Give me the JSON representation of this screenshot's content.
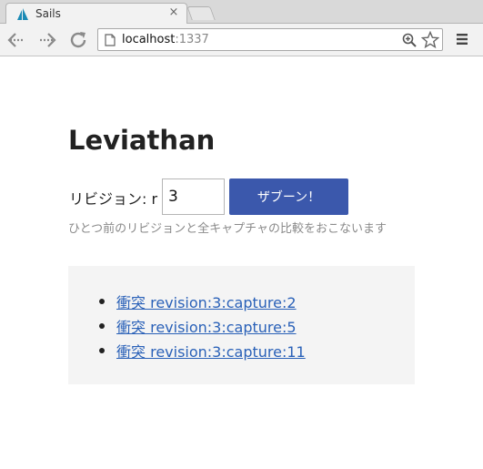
{
  "browser": {
    "tab_title": "Sails",
    "tab_close": "×",
    "url_host": "localhost",
    "url_port": ":1337"
  },
  "page": {
    "title": "Leviathan",
    "revision_label": "リビジョン: r",
    "revision_value": "3",
    "submit_label": "ザブーン！",
    "help_text": "ひとつ前のリビジョンと全キャプチャの比較をおこないます",
    "conflicts": [
      {
        "label": "衝突 revision:3:capture:2"
      },
      {
        "label": "衝突 revision:3:capture:5"
      },
      {
        "label": "衝突 revision:3:capture:11"
      }
    ]
  },
  "colors": {
    "button_bg": "#3b58ac",
    "link": "#2a61b8",
    "panel_bg": "#f4f4f4"
  }
}
